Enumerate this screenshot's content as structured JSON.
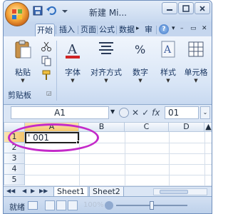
{
  "window": {
    "title": "新建 Mi..."
  },
  "tabs": [
    {
      "label": "开始"
    },
    {
      "label": "插入"
    },
    {
      "label": "页面"
    },
    {
      "label": "公式"
    },
    {
      "label": "数据"
    },
    {
      "label": "审"
    }
  ],
  "ribbon": {
    "clipboard": {
      "paste_label": "粘贴",
      "group_label": "剪贴板"
    },
    "font_label": "字体",
    "align_label": "对齐方式",
    "number_label": "数字",
    "style_label": "样式",
    "cell_label": "单元格"
  },
  "formula_bar": {
    "name_box": "A1",
    "value": "01",
    "fx_label": "fx"
  },
  "grid": {
    "columns": [
      "A",
      "B",
      "C",
      "D"
    ],
    "rows": [
      "1",
      "2",
      "3",
      "4",
      "5"
    ],
    "cell_a1": "' 001"
  },
  "sheets": [
    {
      "label": "Sheet1"
    },
    {
      "label": "Sheet2"
    }
  ],
  "status": {
    "ready": "就绪",
    "zoom": "100%"
  },
  "colors": {
    "highlight_ellipse": "#c42ac9",
    "selected_header": "#f3c56d"
  }
}
